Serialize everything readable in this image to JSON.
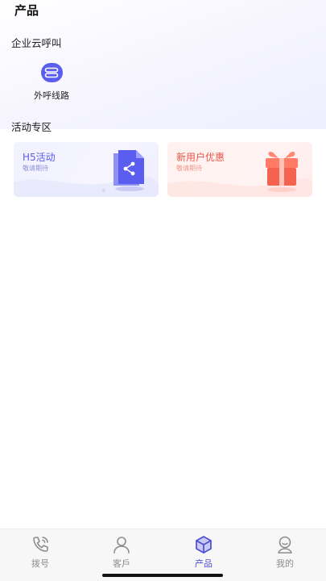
{
  "header": {
    "title": "产品"
  },
  "enterprise": {
    "section_title": "企业云呼叫",
    "items": [
      {
        "label": "外呼线路",
        "icon": "outbound-line-icon"
      }
    ]
  },
  "activities": {
    "section_title": "活动专区",
    "cards": [
      {
        "title": "H5活动",
        "subtitle": "敬请期待",
        "icon": "share-document-icon"
      },
      {
        "title": "新用户优惠",
        "subtitle": "敬请期待",
        "icon": "gift-box-icon"
      }
    ]
  },
  "tabbar": {
    "tabs": [
      {
        "label": "拨号",
        "icon": "phone-icon"
      },
      {
        "label": "客戶",
        "icon": "user-icon"
      },
      {
        "label": "产品",
        "icon": "box-icon",
        "active": true
      },
      {
        "label": "我的",
        "icon": "profile-icon"
      }
    ]
  },
  "colors": {
    "accent": "#5b5df0",
    "tab_active": "#4b4dd6",
    "tab_inactive": "#8d8d8d",
    "promo_red": "#e8584a"
  }
}
